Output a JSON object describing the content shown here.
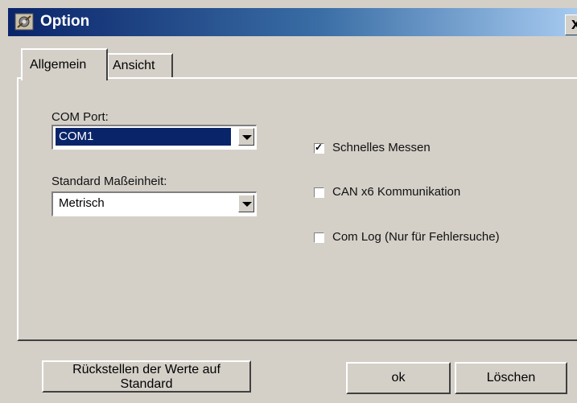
{
  "window": {
    "title": "Option",
    "icon": "settings-gear-icon",
    "close_symbol": "x"
  },
  "tabs": [
    {
      "label": "Allgemein",
      "active": true
    },
    {
      "label": "Ansicht",
      "active": false
    }
  ],
  "com_port": {
    "label": "COM Port:",
    "value": "COM1",
    "focused": true
  },
  "unit": {
    "label": "Standard Maßeinheit:",
    "value": "Metrisch"
  },
  "options": [
    {
      "label": "Schnelles Messen",
      "checked": true
    },
    {
      "label": "CAN x6 Kommunikation",
      "checked": false
    },
    {
      "label": "Com Log (Nur für Fehlersuche)",
      "checked": false
    }
  ],
  "buttons": {
    "reset_line1": "Rückstellen der Werte auf",
    "reset_line2": "Standard",
    "ok": "ok",
    "delete": "Löschen"
  },
  "colors": {
    "title_gradient_start": "#0a246a",
    "title_gradient_end": "#a6caf0",
    "face": "#d4d0c8",
    "selection": "#0a246a"
  }
}
